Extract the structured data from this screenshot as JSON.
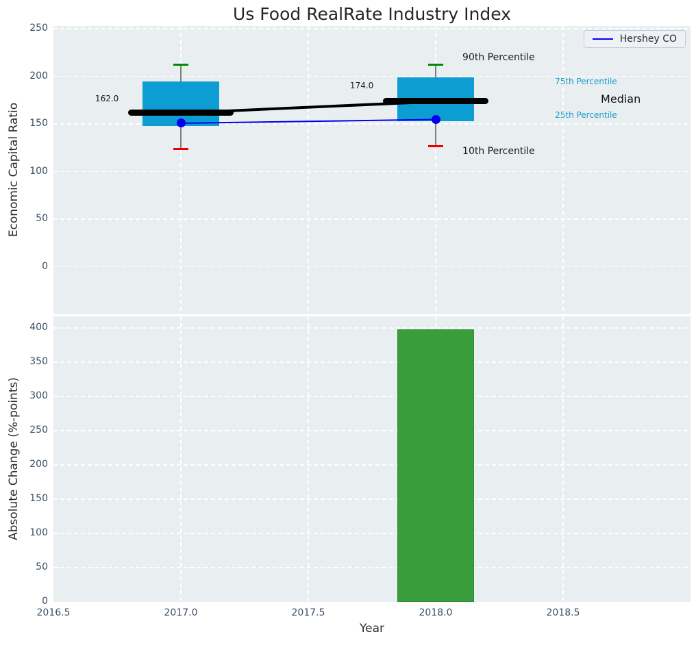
{
  "title": "Us Food RealRate Industry Index",
  "legend": {
    "label": "Hershey CO",
    "line_color": "#0000f0"
  },
  "chart_data": [
    {
      "type": "box-percentile-timeline",
      "title": "Us Food RealRate Industry Index",
      "ylabel": "Economic Capital Ratio",
      "xlabel": "",
      "xlim": [
        2016.5,
        2019.0
      ],
      "ylim": [
        -50,
        253
      ],
      "grid": true,
      "legend_position": "upper right",
      "xtick_values": [
        2016.5,
        2017.0,
        2017.5,
        2018.0,
        2018.5
      ],
      "xtick_labels": [
        "2016.5",
        "2017.0",
        "2017.5",
        "2018.0",
        "2018.5"
      ],
      "show_xtick_labels": false,
      "yticks": [
        0,
        50,
        100,
        150,
        200,
        250
      ],
      "x": [
        2017,
        2018
      ],
      "percentiles": {
        "p90": [
          212,
          212
        ],
        "p75": [
          195,
          199
        ],
        "median": [
          162,
          174
        ],
        "p25": [
          148,
          153
        ],
        "p10": [
          124,
          127
        ]
      },
      "company_series": {
        "name": "Hershey CO",
        "values": [
          151,
          155
        ],
        "color": "#0000f0"
      },
      "median_value_labels": [
        "162.0",
        "174.0"
      ],
      "box_width": 0.3,
      "median_segment_halfwidth": 0.207,
      "cap_halfwidth": 0.03,
      "colors": {
        "box_fill": "#0c9ed3",
        "median_line": "#000000",
        "p90_cap": "#008b00",
        "p10_cap": "#ef0000",
        "whisker": "#7f7f7f",
        "company_line": "#0000f0",
        "plot_bg": "#e9eef0"
      },
      "annotations": [
        {
          "text": "162.0",
          "x": 2016.71,
          "y": 176.7,
          "size": 12,
          "color": "#1a1a1a",
          "align": "center"
        },
        {
          "text": "174.0",
          "x": 2017.71,
          "y": 190.4,
          "size": 12,
          "color": "#1a1a1a",
          "align": "center"
        },
        {
          "text": "90th Percentile",
          "x": 2018.105,
          "y": 219.2,
          "size": 14,
          "color": "#1a1a1a",
          "align": "left"
        },
        {
          "text": "10th Percentile",
          "x": 2018.105,
          "y": 120.6,
          "size": 14,
          "color": "#1a1a1a",
          "align": "left"
        },
        {
          "text": "75th Percentile",
          "x": 2018.468,
          "y": 194.7,
          "size": 12,
          "color": "#1a9cce",
          "align": "left"
        },
        {
          "text": "Median",
          "x": 2018.648,
          "y": 176.0,
          "size": 16,
          "color": "#111111",
          "align": "left"
        },
        {
          "text": "25th Percentile",
          "x": 2018.468,
          "y": 159.4,
          "size": 12,
          "color": "#1a9cce",
          "align": "left"
        }
      ]
    },
    {
      "type": "bar",
      "ylabel": "Absolute Change (%-points)",
      "xlabel": "Year",
      "xlim": [
        2016.5,
        2019.0
      ],
      "ylim": [
        0,
        417
      ],
      "grid": true,
      "xtick_values": [
        2016.5,
        2017.0,
        2017.5,
        2018.0,
        2018.5
      ],
      "xtick_labels": [
        "2016.5",
        "2017.0",
        "2017.5",
        "2018.0",
        "2018.5"
      ],
      "show_xtick_labels": true,
      "yticks": [
        0,
        50,
        100,
        150,
        200,
        250,
        300,
        350,
        400
      ],
      "categories": [
        2018
      ],
      "values": [
        398
      ],
      "bar_width": 0.3,
      "bar_color": "#3a9d3c",
      "bar_edge_color": "#2f8f33"
    }
  ]
}
